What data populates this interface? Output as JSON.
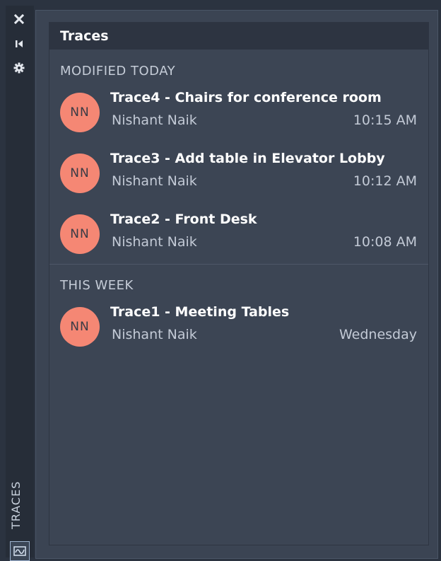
{
  "toolbar": {
    "close_icon": "close-icon",
    "collapse_icon": "collapse-icon",
    "settings_icon": "gear-icon",
    "tab_label": "TRACES",
    "tab_icon": "traces-icon"
  },
  "palette": {
    "title": "Traces"
  },
  "sections": [
    {
      "heading": "MODIFIED TODAY",
      "items": [
        {
          "initials": "NN",
          "title": "Trace4 - Chairs for conference room",
          "author": "Nishant Naik",
          "time": "10:15 AM"
        },
        {
          "initials": "NN",
          "title": "Trace3 - Add table in Elevator Lobby",
          "author": "Nishant Naik",
          "time": "10:12 AM"
        },
        {
          "initials": "NN",
          "title": "Trace2 - Front Desk",
          "author": "Nishant Naik",
          "time": "10:08 AM"
        }
      ]
    },
    {
      "heading": "THIS WEEK",
      "items": [
        {
          "initials": "NN",
          "title": "Trace1 - Meeting Tables",
          "author": "Nishant Naik",
          "time": "Wednesday"
        }
      ]
    }
  ],
  "colors": {
    "avatar": "#f58774",
    "background": "#3b4453",
    "header": "#2d3441"
  }
}
